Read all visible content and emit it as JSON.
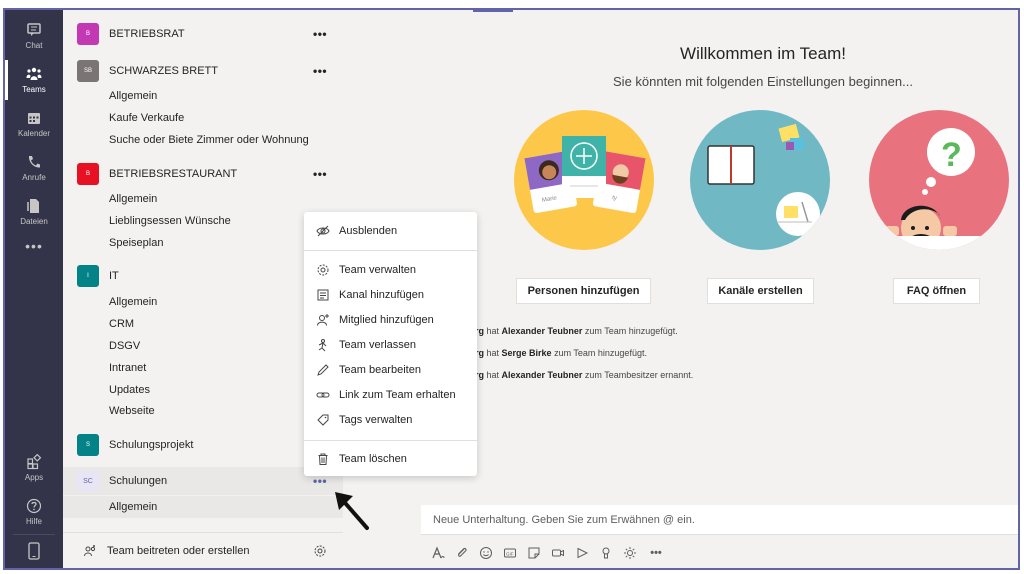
{
  "rail": {
    "items": [
      {
        "label": "Chat",
        "icon": "chat-icon"
      },
      {
        "label": "Teams",
        "icon": "teams-icon",
        "active": true
      },
      {
        "label": "Kalender",
        "icon": "calendar-icon"
      },
      {
        "label": "Anrufe",
        "icon": "phone-icon"
      },
      {
        "label": "Dateien",
        "icon": "file-icon"
      }
    ],
    "more": "•••",
    "bottom": [
      {
        "label": "Apps",
        "icon": "apps-icon"
      },
      {
        "label": "Hilfe",
        "icon": "help-icon"
      }
    ]
  },
  "teams": [
    {
      "initials": "B",
      "name": "BETRIEBSRAT",
      "color": "#c239b3",
      "dots": "•••"
    },
    {
      "initials": "SB",
      "name": "SCHWARZES BRETT",
      "color": "#7a7574",
      "dots": "•••",
      "channels": [
        "Allgemein",
        "Kaufe Verkaufe",
        "Suche oder Biete Zimmer oder Wohnung"
      ]
    },
    {
      "initials": "B",
      "name": "BETRIEBSRESTAURANT",
      "color": "#e81123",
      "dots": "•••",
      "channels": [
        "Allgemein",
        "Lieblingsessen Wünsche",
        "Speiseplan"
      ]
    },
    {
      "initials": "I",
      "name": "IT",
      "color": "#038387",
      "channels": [
        "Allgemein",
        "CRM",
        "DSGV",
        "Intranet",
        "Updates",
        "Webseite"
      ]
    },
    {
      "initials": "S",
      "name": "Schulungsprojekt",
      "color": "#038387"
    },
    {
      "initials": "SC",
      "name": "Schulungen",
      "color": "#e8e6f4",
      "dots": "•••",
      "channels": [
        "Allgemein"
      ]
    }
  ],
  "join": {
    "label": "Team beitreten oder erstellen"
  },
  "main": {
    "title": "Willkommen im Team!",
    "subtitle": "Sie könnten mit folgenden Einstellungen beginnen...",
    "illustration_labels": {
      "card_left": "Marie",
      "card_right": "ty"
    },
    "actions": [
      {
        "label": "Personen hinzufügen"
      },
      {
        "label": "Kanäle erstellen"
      },
      {
        "label": "FAQ öffnen"
      }
    ],
    "activity": [
      {
        "prefix": "erg",
        "mid": " hat ",
        "person": "Alexander Teubner",
        "suffix": " zum Team hinzugefügt."
      },
      {
        "prefix": "erg",
        "mid": " hat ",
        "person": "Serge Birke",
        "suffix": " zum Team hinzugefügt."
      },
      {
        "prefix": "erg",
        "mid": " hat ",
        "person": "Alexander Teubner",
        "suffix": " zum Teambesitzer ernannt."
      }
    ],
    "compose_placeholder": "Neue Unterhaltung. Geben Sie zum Erwähnen @ ein.",
    "toolbar_more": "•••"
  },
  "menu": {
    "items": [
      {
        "label": "Ausblenden",
        "icon": "hide-icon"
      },
      {
        "label": "Team verwalten",
        "icon": "gear-icon"
      },
      {
        "label": "Kanal hinzufügen",
        "icon": "channel-add-icon"
      },
      {
        "label": "Mitglied hinzufügen",
        "icon": "person-add-icon"
      },
      {
        "label": "Team verlassen",
        "icon": "leave-icon"
      },
      {
        "label": "Team bearbeiten",
        "icon": "pencil-icon"
      },
      {
        "label": "Link zum Team erhalten",
        "icon": "link-icon"
      },
      {
        "label": "Tags verwalten",
        "icon": "tag-icon"
      },
      {
        "label": "Team löschen",
        "icon": "trash-icon"
      }
    ]
  },
  "colors": {
    "accent": "#6264a7",
    "rail": "#33344a"
  }
}
